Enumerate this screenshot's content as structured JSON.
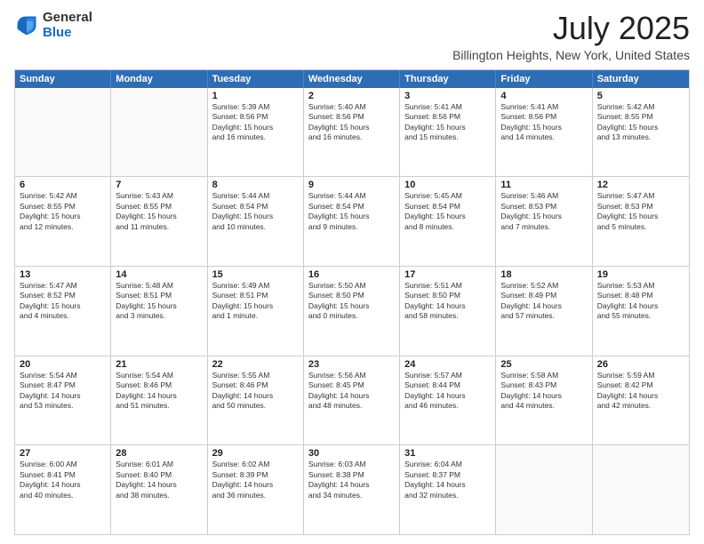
{
  "logo": {
    "general": "General",
    "blue": "Blue"
  },
  "title": "July 2025",
  "subtitle": "Billington Heights, New York, United States",
  "days": [
    "Sunday",
    "Monday",
    "Tuesday",
    "Wednesday",
    "Thursday",
    "Friday",
    "Saturday"
  ],
  "weeks": [
    [
      {
        "day": "",
        "info": ""
      },
      {
        "day": "",
        "info": ""
      },
      {
        "day": "1",
        "info": "Sunrise: 5:39 AM\nSunset: 8:56 PM\nDaylight: 15 hours\nand 16 minutes."
      },
      {
        "day": "2",
        "info": "Sunrise: 5:40 AM\nSunset: 8:56 PM\nDaylight: 15 hours\nand 16 minutes."
      },
      {
        "day": "3",
        "info": "Sunrise: 5:41 AM\nSunset: 8:56 PM\nDaylight: 15 hours\nand 15 minutes."
      },
      {
        "day": "4",
        "info": "Sunrise: 5:41 AM\nSunset: 8:56 PM\nDaylight: 15 hours\nand 14 minutes."
      },
      {
        "day": "5",
        "info": "Sunrise: 5:42 AM\nSunset: 8:55 PM\nDaylight: 15 hours\nand 13 minutes."
      }
    ],
    [
      {
        "day": "6",
        "info": "Sunrise: 5:42 AM\nSunset: 8:55 PM\nDaylight: 15 hours\nand 12 minutes."
      },
      {
        "day": "7",
        "info": "Sunrise: 5:43 AM\nSunset: 8:55 PM\nDaylight: 15 hours\nand 11 minutes."
      },
      {
        "day": "8",
        "info": "Sunrise: 5:44 AM\nSunset: 8:54 PM\nDaylight: 15 hours\nand 10 minutes."
      },
      {
        "day": "9",
        "info": "Sunrise: 5:44 AM\nSunset: 8:54 PM\nDaylight: 15 hours\nand 9 minutes."
      },
      {
        "day": "10",
        "info": "Sunrise: 5:45 AM\nSunset: 8:54 PM\nDaylight: 15 hours\nand 8 minutes."
      },
      {
        "day": "11",
        "info": "Sunrise: 5:46 AM\nSunset: 8:53 PM\nDaylight: 15 hours\nand 7 minutes."
      },
      {
        "day": "12",
        "info": "Sunrise: 5:47 AM\nSunset: 8:53 PM\nDaylight: 15 hours\nand 5 minutes."
      }
    ],
    [
      {
        "day": "13",
        "info": "Sunrise: 5:47 AM\nSunset: 8:52 PM\nDaylight: 15 hours\nand 4 minutes."
      },
      {
        "day": "14",
        "info": "Sunrise: 5:48 AM\nSunset: 8:51 PM\nDaylight: 15 hours\nand 3 minutes."
      },
      {
        "day": "15",
        "info": "Sunrise: 5:49 AM\nSunset: 8:51 PM\nDaylight: 15 hours\nand 1 minute."
      },
      {
        "day": "16",
        "info": "Sunrise: 5:50 AM\nSunset: 8:50 PM\nDaylight: 15 hours\nand 0 minutes."
      },
      {
        "day": "17",
        "info": "Sunrise: 5:51 AM\nSunset: 8:50 PM\nDaylight: 14 hours\nand 58 minutes."
      },
      {
        "day": "18",
        "info": "Sunrise: 5:52 AM\nSunset: 8:49 PM\nDaylight: 14 hours\nand 57 minutes."
      },
      {
        "day": "19",
        "info": "Sunrise: 5:53 AM\nSunset: 8:48 PM\nDaylight: 14 hours\nand 55 minutes."
      }
    ],
    [
      {
        "day": "20",
        "info": "Sunrise: 5:54 AM\nSunset: 8:47 PM\nDaylight: 14 hours\nand 53 minutes."
      },
      {
        "day": "21",
        "info": "Sunrise: 5:54 AM\nSunset: 8:46 PM\nDaylight: 14 hours\nand 51 minutes."
      },
      {
        "day": "22",
        "info": "Sunrise: 5:55 AM\nSunset: 8:46 PM\nDaylight: 14 hours\nand 50 minutes."
      },
      {
        "day": "23",
        "info": "Sunrise: 5:56 AM\nSunset: 8:45 PM\nDaylight: 14 hours\nand 48 minutes."
      },
      {
        "day": "24",
        "info": "Sunrise: 5:57 AM\nSunset: 8:44 PM\nDaylight: 14 hours\nand 46 minutes."
      },
      {
        "day": "25",
        "info": "Sunrise: 5:58 AM\nSunset: 8:43 PM\nDaylight: 14 hours\nand 44 minutes."
      },
      {
        "day": "26",
        "info": "Sunrise: 5:59 AM\nSunset: 8:42 PM\nDaylight: 14 hours\nand 42 minutes."
      }
    ],
    [
      {
        "day": "27",
        "info": "Sunrise: 6:00 AM\nSunset: 8:41 PM\nDaylight: 14 hours\nand 40 minutes."
      },
      {
        "day": "28",
        "info": "Sunrise: 6:01 AM\nSunset: 8:40 PM\nDaylight: 14 hours\nand 38 minutes."
      },
      {
        "day": "29",
        "info": "Sunrise: 6:02 AM\nSunset: 8:39 PM\nDaylight: 14 hours\nand 36 minutes."
      },
      {
        "day": "30",
        "info": "Sunrise: 6:03 AM\nSunset: 8:38 PM\nDaylight: 14 hours\nand 34 minutes."
      },
      {
        "day": "31",
        "info": "Sunrise: 6:04 AM\nSunset: 8:37 PM\nDaylight: 14 hours\nand 32 minutes."
      },
      {
        "day": "",
        "info": ""
      },
      {
        "day": "",
        "info": ""
      }
    ]
  ]
}
